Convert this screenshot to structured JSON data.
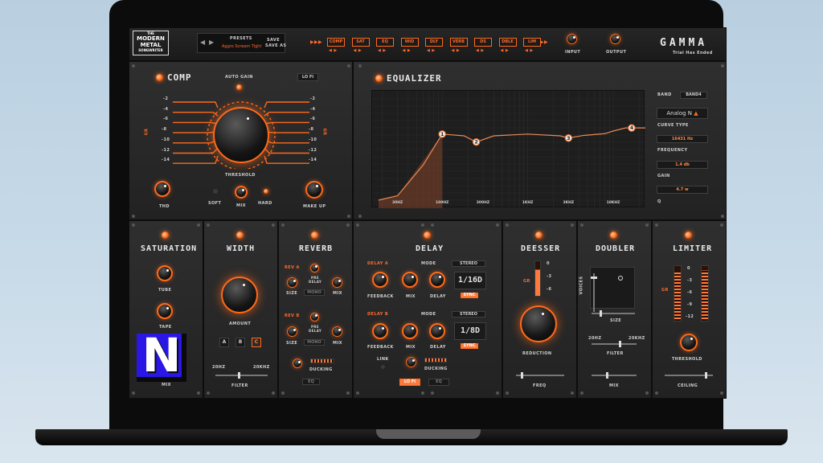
{
  "brand": {
    "logo_top": "THE",
    "logo_main": "MODERN METAL",
    "logo_sub": "SONGWRITER"
  },
  "header": {
    "presets_label": "PRESETS",
    "preset_name": "Aggro Scream Tight",
    "save_label": "SAVE",
    "save_as_label": "SAVE AS",
    "chain": [
      "COMP",
      "SAT",
      "EQ",
      "WID",
      "DLY",
      "VERB",
      "DS",
      "DBLE",
      "LIM"
    ],
    "input_label": "INPUT",
    "output_label": "OUTPUT",
    "product_name": "GAMMA",
    "trial_text": "Trial Has Ended"
  },
  "comp": {
    "title": "COMP",
    "auto_gain": "AUTO GAIN",
    "lo_fi": "LO FI",
    "scale": [
      "-2",
      "-4",
      "-6",
      "-8",
      "-10",
      "-12",
      "-14"
    ],
    "gr": "GR",
    "threshold": "THRESHOLD",
    "thd": "THD",
    "soft": "SOFT",
    "mix": "MIX",
    "hard": "HARD",
    "make_up": "MAKE UP"
  },
  "eq": {
    "title": "EQUALIZER",
    "freqs": [
      "30HZ",
      "100HZ",
      "300HZ",
      "1KHZ",
      "3KHZ",
      "10KHZ"
    ],
    "nodes": [
      "1",
      "2",
      "3",
      "4"
    ],
    "band_label": "BAND",
    "band_value": "BAND4",
    "filter_type": "Analog N",
    "curve_type": "CURVE TYPE",
    "freq_value": "16431 Hz",
    "frequency": "FREQUENCY",
    "gain_value": "1.4 db",
    "gain": "GAIN",
    "q_value": "4.7 w",
    "q": "Q",
    "curve": [
      [
        30,
        -14
      ],
      [
        60,
        -7
      ],
      [
        100,
        0
      ],
      [
        180,
        -0.4
      ],
      [
        250,
        -1.8
      ],
      [
        400,
        -0.4
      ],
      [
        1000,
        0
      ],
      [
        2400,
        -0.4
      ],
      [
        3000,
        -0.9
      ],
      [
        4500,
        -0.3
      ],
      [
        8000,
        0.1
      ],
      [
        10000,
        0.7
      ],
      [
        14000,
        1.4
      ],
      [
        16431,
        1.4
      ]
    ],
    "node_points": [
      [
        100,
        0
      ],
      [
        250,
        -1.8
      ],
      [
        3000,
        -0.9
      ],
      [
        16431,
        1.4
      ]
    ],
    "db_range": [
      -15,
      8
    ],
    "freq_range": [
      18,
      20000
    ]
  },
  "saturation": {
    "title": "SATURATION",
    "tube": "TUBE",
    "tape": "TAPE",
    "mix": "MIX"
  },
  "width": {
    "title": "WIDTH",
    "amount": "AMOUNT",
    "modes": [
      "A",
      "B",
      "C"
    ],
    "lo": "20HZ",
    "hi": "20KHZ",
    "filter": "FILTER"
  },
  "reverb": {
    "title": "REVERB",
    "rev_a": "REV A",
    "rev_b": "REV B",
    "pre_delay": "PRE DELAY",
    "size": "SIZE",
    "mode": "MONO",
    "mix": "MIX",
    "ducking": "DUCKING",
    "eq": "EQ"
  },
  "delay": {
    "title": "DELAY",
    "delay_a": "DELAY A",
    "delay_b": "DELAY B",
    "mode": "MODE",
    "stereo": "STEREO",
    "feedback": "FEEDBACK",
    "mix": "MIX",
    "delay": "DELAY",
    "time_a": "1/16D",
    "time_b": "1/8D",
    "sync": "SYNC",
    "link": "LINK",
    "ducking": "DUCKING",
    "lo_fi": "LO FI",
    "eq": "EQ"
  },
  "deesser": {
    "title": "DEESSER",
    "scale": [
      "0",
      "-3",
      "-6"
    ],
    "gr": "GR",
    "reduction": "REDUCTION",
    "freq": "FREQ"
  },
  "doubler": {
    "title": "DOUBLER",
    "voices": "VOICES",
    "size": "SIZE",
    "lo": "20HZ",
    "hi": "20KHZ",
    "filter": "FILTER",
    "mix": "MIX"
  },
  "limiter": {
    "title": "LIMITER",
    "scale": [
      "0",
      "-3",
      "-6",
      "-9",
      "-12"
    ],
    "gr": "GR",
    "threshold": "THRESHOLD",
    "ceiling": "CEILING"
  },
  "overlay": {
    "badge": "N"
  },
  "colors": {
    "accent": "#ff6a1a",
    "panel": "#2a2a2a",
    "badge": "#2a16e6"
  }
}
